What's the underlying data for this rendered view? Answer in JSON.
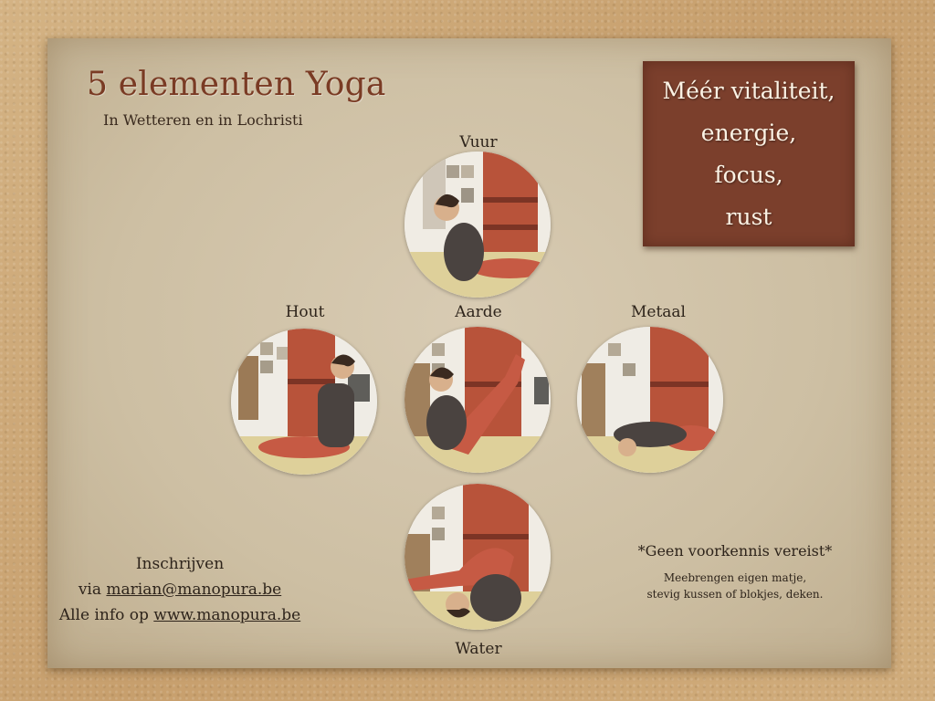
{
  "title": "5 elementen Yoga",
  "subtitle": "In Wetteren en in Lochristi",
  "promo": [
    "Méér vitaliteit,",
    "energie,",
    "focus,",
    "rust"
  ],
  "elements": {
    "vuur": "Vuur",
    "hout": "Hout",
    "aarde": "Aarde",
    "metaal": "Metaal",
    "water": "Water"
  },
  "signup": {
    "heading": "Inschrijven",
    "via_prefix": "via ",
    "email": "marian@manopura.be",
    "info_prefix": "Alle info op ",
    "website": "www.manopura.be"
  },
  "note": {
    "main": "*Geen voorkennis vereist*",
    "line1": "Meebrengen eigen matje,",
    "line2": "stevig kussen of blokjes, deken."
  },
  "colors": {
    "title": "#7a3b24",
    "promo_bg": "#7b3f2c",
    "curtain": "#b8533a",
    "sweater": "#4a4340",
    "pants": "#c65a44"
  }
}
